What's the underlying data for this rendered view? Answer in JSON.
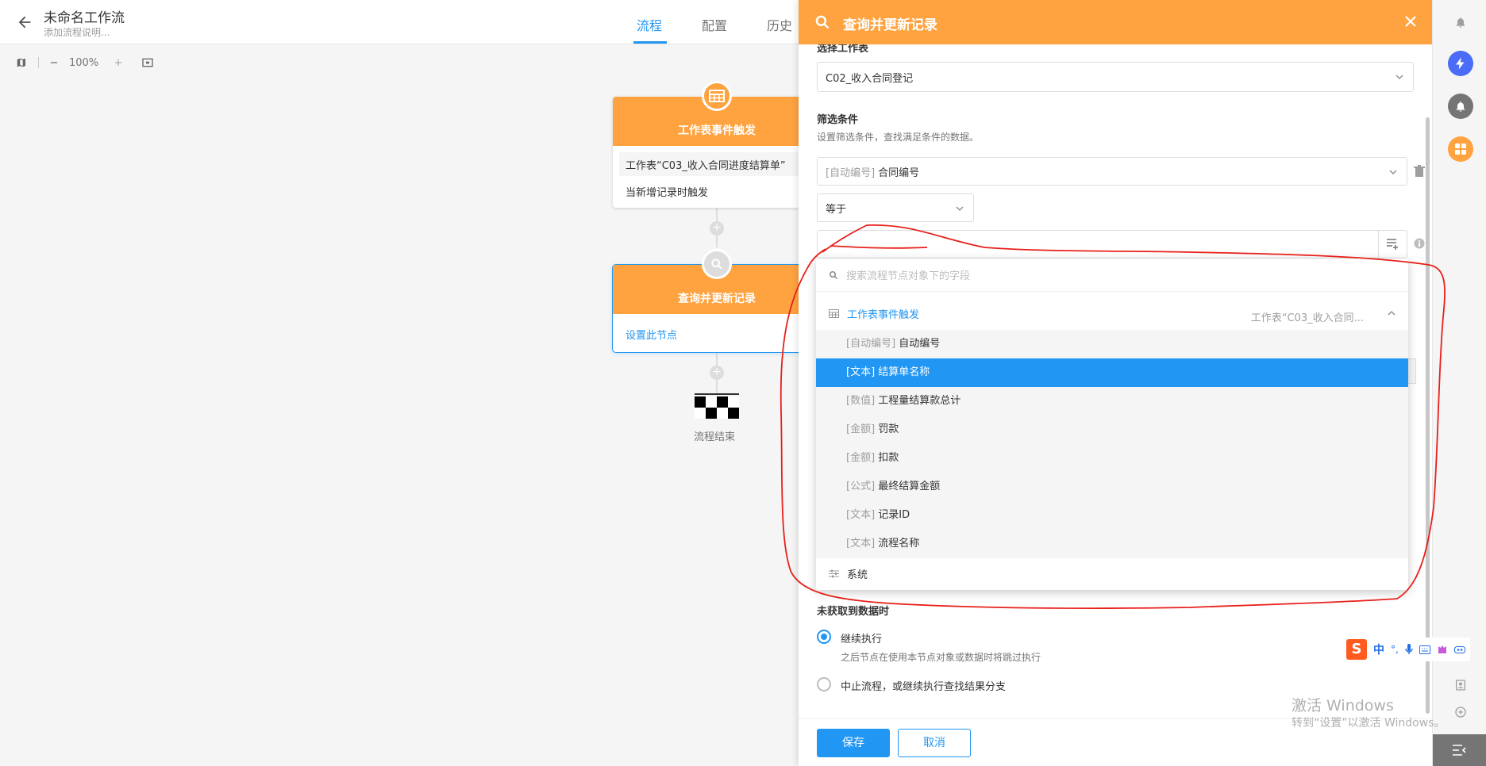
{
  "header": {
    "back_icon": "arrow-left-icon",
    "title": "未命名工作流",
    "description": "添加流程说明...",
    "tabs": [
      {
        "label": "流程",
        "active": true
      },
      {
        "label": "配置",
        "active": false
      },
      {
        "label": "历史",
        "active": false
      }
    ]
  },
  "toolbar": {
    "map_icon": "map-icon",
    "zoom_out_icon": "minus-icon",
    "zoom": "100%",
    "zoom_in_icon": "plus-icon",
    "fit_icon": "fit-screen-icon"
  },
  "canvas": {
    "trigger_node": {
      "icon": "table-icon",
      "title": "工作表事件触发",
      "worksheet": "工作表“C03_收入合同进度结算单”",
      "condition": "当新增记录时触发"
    },
    "add_1": "+",
    "query_node": {
      "icon": "search-icon",
      "title": "查询并更新记录",
      "link": "设置此节点"
    },
    "add_2": "+",
    "end_icon": "checkered-flag-icon",
    "end_label": "流程结束"
  },
  "panel": {
    "title": "查询并更新记录",
    "title_icon": "search-icon",
    "close_icon": "close-icon",
    "select_sheet_label": "选择工作表",
    "sheet_value": "C02_收入合同登记",
    "filter_label": "筛选条件",
    "filter_hint": "设置筛选条件，查找满足条件的数据。",
    "field_tag": "[自动编号]",
    "field_name": "合同编号",
    "operator": "等于",
    "delete_icon": "trash-icon",
    "insert_field_icon": "insert-field-icon",
    "info_icon": "info-icon",
    "dropdown": {
      "search_placeholder": "搜索流程节点对象下的字段",
      "group": {
        "title": "工作表事件触发",
        "subtitle": "工作表“C03_收入合同...",
        "icon": "table-icon"
      },
      "items": [
        {
          "tag": "[自动编号]",
          "name": "自动编号",
          "selected": false
        },
        {
          "tag": "[文本]",
          "name": "结算单名称",
          "selected": true
        },
        {
          "tag": "[数值]",
          "name": "工程量结算款总计",
          "selected": false
        },
        {
          "tag": "[金额]",
          "name": "罚款",
          "selected": false
        },
        {
          "tag": "[金额]",
          "name": "扣款",
          "selected": false
        },
        {
          "tag": "[公式]",
          "name": "最终结算金额",
          "selected": false
        },
        {
          "tag": "[文本]",
          "name": "记录ID",
          "selected": false
        },
        {
          "tag": "[文本]",
          "name": "流程名称",
          "selected": false
        }
      ],
      "system_label": "系统",
      "system_icon": "sliders-icon"
    },
    "no_data_label": "未获取到数据时",
    "option_continue": "继续执行",
    "option_continue_hint": "之后节点在使用本节点对象或数据时将跳过执行",
    "option_stop": "中止流程，或继续执行查找结果分支",
    "save": "保存",
    "cancel": "取消"
  },
  "rail": {
    "icons": [
      "bell-icon",
      "lightning-icon",
      "notification-icon",
      "apps-icon",
      "contacts-icon",
      "chat-add-icon",
      "collapse-icon"
    ]
  },
  "ime": {
    "logo": "S",
    "mode": "中",
    "punct": "°,"
  },
  "watermark": {
    "line1": "激活 Windows",
    "line2": "转到“设置”以激活 Windows。"
  },
  "colors": {
    "accent": "#2196f3",
    "node_orange": "#ffa340",
    "annotation_red": "#e8201a"
  }
}
